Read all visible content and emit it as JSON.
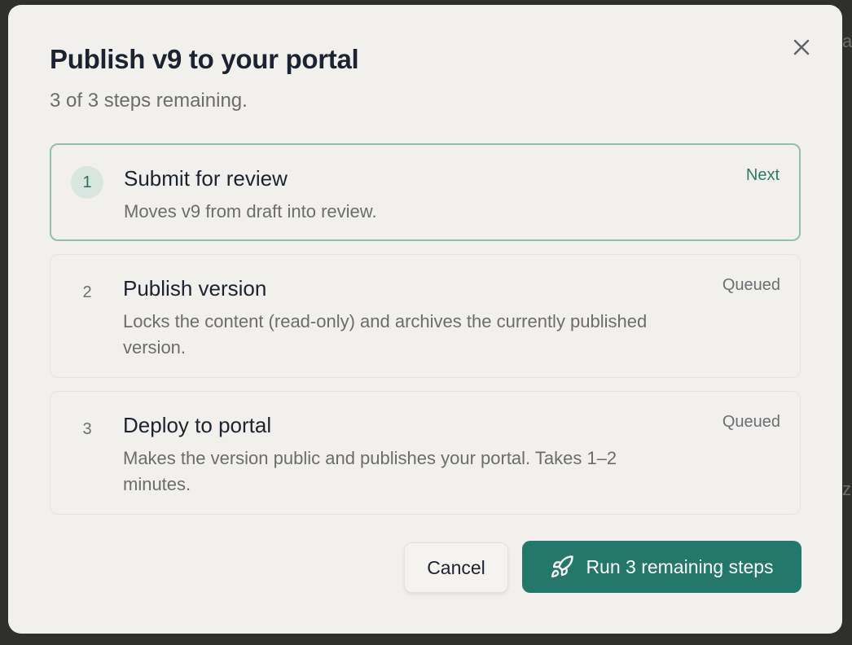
{
  "modal": {
    "title": "Publish v9 to your portal",
    "subtitle": "3 of 3 steps remaining."
  },
  "steps": [
    {
      "number": "1",
      "title": "Submit for review",
      "description": "Moves v9 from draft into review.",
      "status": "Next"
    },
    {
      "number": "2",
      "title": "Publish version",
      "description": "Locks the content (read-only) and archives the currently published version.",
      "status": "Queued"
    },
    {
      "number": "3",
      "title": "Deploy to portal",
      "description": "Makes the version public and publishes your portal. Takes 1–2 minutes.",
      "status": "Queued"
    }
  ],
  "actions": {
    "cancel_label": "Cancel",
    "run_label": "Run 3 remaining steps"
  },
  "icons": {
    "close": "close-icon",
    "run": "rocket-icon"
  },
  "colors": {
    "accent": "#23786a",
    "active_border": "#92bfaa"
  }
}
